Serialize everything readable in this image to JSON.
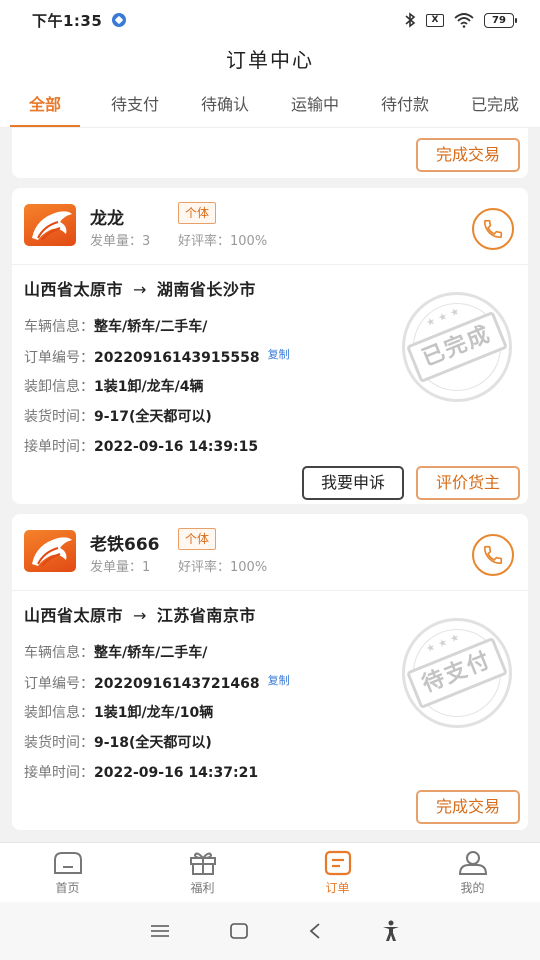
{
  "status": {
    "time": "下午1:35",
    "battery": "79",
    "x_icon": "X"
  },
  "header": {
    "title": "订单中心"
  },
  "tabs": [
    "全部",
    "待支付",
    "待确认",
    "运输中",
    "待付款",
    "已完成"
  ],
  "prev_card": {
    "button": "完成交易"
  },
  "orders": [
    {
      "name": "龙龙",
      "tag": "个体",
      "orders_count_label": "发单量：3",
      "rating_label": "好评率：100%",
      "origin": "山西省太原市",
      "arrow": "→",
      "destination": "湖南省长沙市",
      "vehicle_label": "车辆信息：",
      "vehicle": "整车/轿车/二手车/",
      "order_no_label": "订单编号：",
      "order_no": "20220916143915558",
      "copy": "复制",
      "load_label": "装卸信息：",
      "load": "1装1卸/龙车/4辆",
      "load_time_label": "装货时间：",
      "load_time": "9-17(全天都可以)",
      "accept_label": "接单时间：",
      "accept_time": "2022-09-16 14:39:15",
      "stamp": "已完成",
      "buttons": [
        "我要申诉",
        "评价货主"
      ]
    },
    {
      "name": "老铁666",
      "tag": "个体",
      "orders_count_label": "发单量：1",
      "rating_label": "好评率：100%",
      "origin": "山西省太原市",
      "arrow": "→",
      "destination": "江苏省南京市",
      "vehicle_label": "车辆信息：",
      "vehicle": "整车/轿车/二手车/",
      "order_no_label": "订单编号：",
      "order_no": "20220916143721468",
      "copy": "复制",
      "load_label": "装卸信息：",
      "load": "1装1卸/龙车/10辆",
      "load_time_label": "装货时间：",
      "load_time": "9-18(全天都可以)",
      "accept_label": "接单时间：",
      "accept_time": "2022-09-16 14:37:21",
      "stamp": "待支付",
      "buttons": [
        "完成交易"
      ]
    }
  ],
  "tabbar": [
    "首页",
    "福利",
    "订单",
    "我的"
  ],
  "colors": {
    "accent": "#e8792a",
    "button_border": "#e8a06a"
  }
}
